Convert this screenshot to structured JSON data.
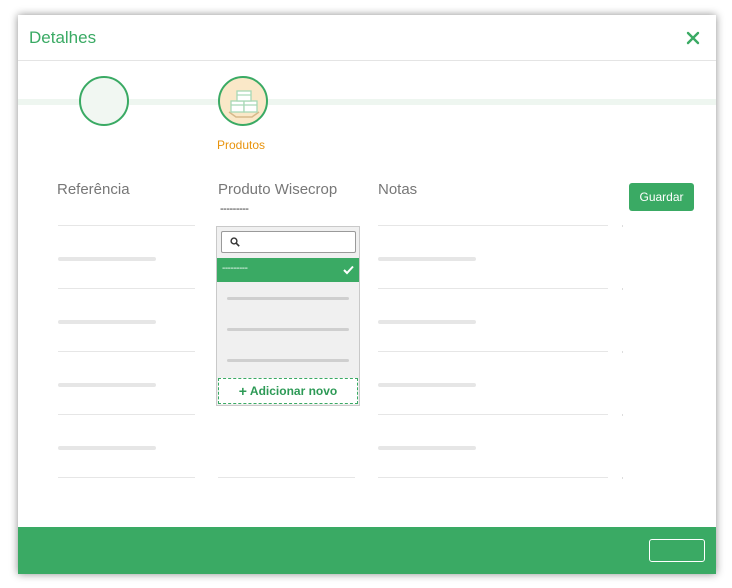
{
  "header": {
    "title": "Detalhes",
    "close_icon": "close-icon"
  },
  "steps": [
    {
      "icon": ""
    },
    {
      "icon": "boxes-icon",
      "label": "Produtos"
    }
  ],
  "columns": {
    "reference": "Referência",
    "product": "Produto Wisecrop",
    "notes": "Notas"
  },
  "product_current_value": "---------",
  "save_label": "Guardar",
  "dropdown": {
    "search_placeholder": "",
    "selected_label": "---------",
    "add_new_label": "Adicionar novo"
  },
  "colors": {
    "accent": "#3aaa64",
    "step_active": "#e8930c",
    "step_fill": "#fae8c8"
  }
}
